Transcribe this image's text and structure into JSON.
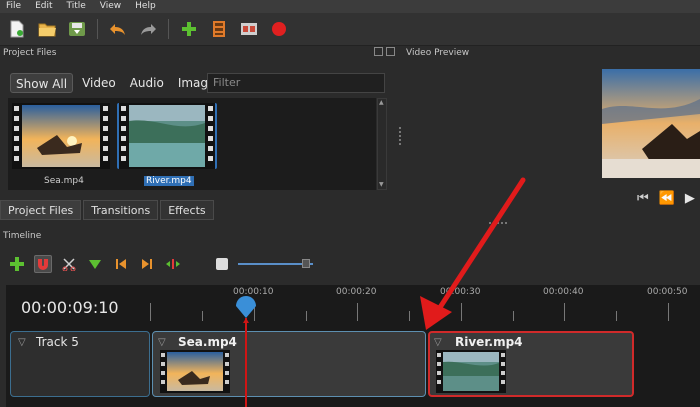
{
  "menu": [
    "File",
    "Edit",
    "Title",
    "View",
    "Help"
  ],
  "toolbar": {
    "icons": [
      "new-project-icon",
      "open-project-icon",
      "save-project-icon",
      "undo-icon",
      "redo-icon",
      "add-file-icon",
      "choose-profile-icon",
      "fullscreen-icon",
      "export-icon"
    ]
  },
  "panels": {
    "project_files_title": "Project Files",
    "video_preview_title": "Video Preview",
    "timeline_title": "Timeline"
  },
  "filters": {
    "buttons": [
      "Show All",
      "Video",
      "Audio",
      "Image"
    ],
    "placeholder": "Filter"
  },
  "files": [
    {
      "name": "Sea.mp4",
      "selected": false
    },
    {
      "name": "River.mp4",
      "selected": true
    }
  ],
  "bottom_tabs": [
    "Project Files",
    "Transitions",
    "Effects"
  ],
  "timeline": {
    "timecode": "00:00:09:10",
    "ruler": [
      "00:00:10",
      "00:00:20",
      "00:00:30",
      "00:00:40",
      "00:00:50"
    ],
    "track": "Track 5",
    "clips": [
      {
        "name": "Sea.mp4"
      },
      {
        "name": "River.mp4"
      }
    ]
  },
  "colors": {
    "accent_blue": "#2f6fb5",
    "playhead_red": "#d01515",
    "arrow_red": "#e11b1b",
    "selection_red": "#d02a2a"
  }
}
